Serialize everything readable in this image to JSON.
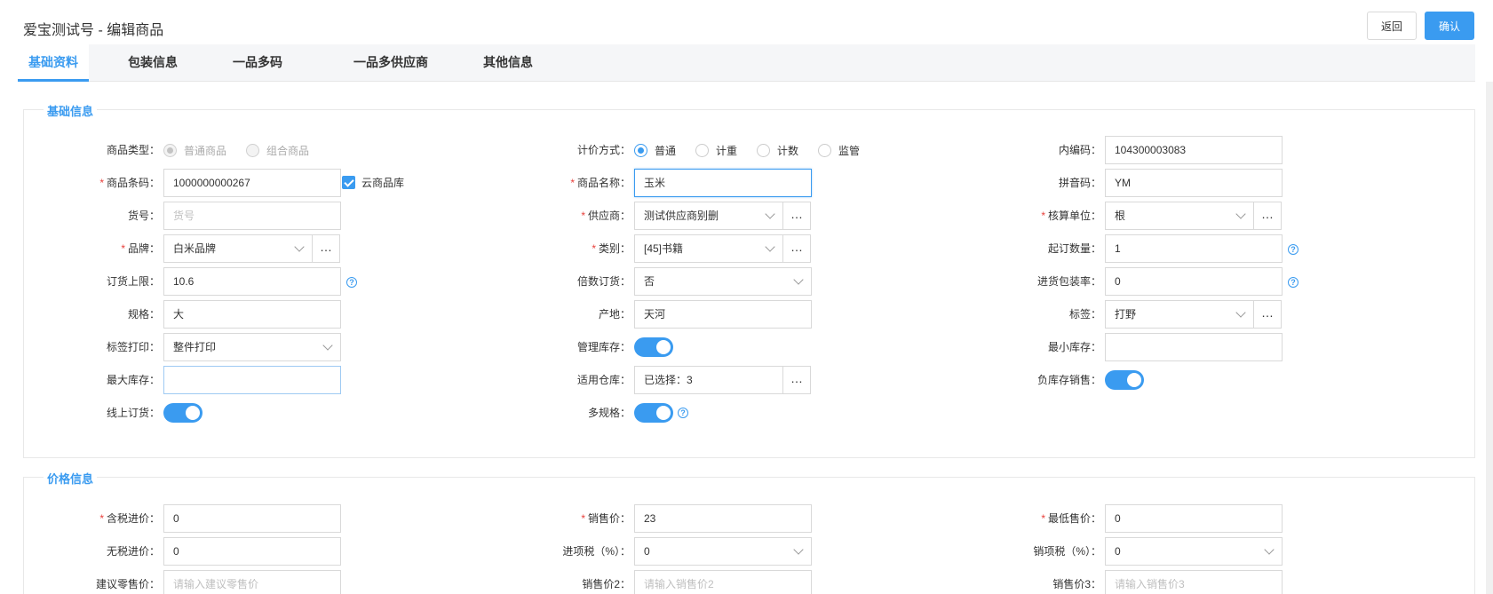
{
  "header": {
    "title": "爱宝测试号 - 编辑商品",
    "back_label": "返回",
    "confirm_label": "确认"
  },
  "tabs": [
    "基础资料",
    "包装信息",
    "一品多码",
    "一品多供应商",
    "其他信息"
  ],
  "basic": {
    "section_title": "基础信息",
    "product_type": {
      "label": "商品类型：",
      "options": [
        "普通商品",
        "组合商品"
      ]
    },
    "pricing_method": {
      "label": "计价方式：",
      "options": [
        "普通",
        "计重",
        "计数",
        "监管"
      ]
    },
    "internal_code": {
      "label": "内编码：",
      "value": "104300003083"
    },
    "barcode": {
      "label": "商品条码：",
      "value": "1000000000267",
      "cloud_label": "云商品库"
    },
    "name": {
      "label": "商品名称：",
      "value": "玉米"
    },
    "pinyin": {
      "label": "拼音码：",
      "value": "YM"
    },
    "item_no": {
      "label": "货号：",
      "placeholder": "货号"
    },
    "supplier": {
      "label": "供应商：",
      "value": "测试供应商别删"
    },
    "unit": {
      "label": "核算单位：",
      "value": "根"
    },
    "brand": {
      "label": "品牌：",
      "value": "白米品牌"
    },
    "category": {
      "label": "类别：",
      "value": "[45]书籍"
    },
    "min_order": {
      "label": "起订数量：",
      "value": "1"
    },
    "order_limit": {
      "label": "订货上限：",
      "value": "10.6"
    },
    "multiple_order": {
      "label": "倍数订货：",
      "value": "否"
    },
    "purchase_pack_rate": {
      "label": "进货包装率：",
      "value": "0"
    },
    "spec": {
      "label": "规格：",
      "value": "大"
    },
    "origin": {
      "label": "产地：",
      "value": "天河"
    },
    "tag": {
      "label": "标签：",
      "value": "打野"
    },
    "label_print": {
      "label": "标签打印：",
      "value": "整件打印"
    },
    "manage_stock": {
      "label": "管理库存："
    },
    "min_stock": {
      "label": "最小库存：",
      "value": ""
    },
    "max_stock": {
      "label": "最大库存：",
      "value": ""
    },
    "warehouses": {
      "label": "适用仓库：",
      "value": "已选择：3"
    },
    "negative_stock_sale": {
      "label": "负库存销售："
    },
    "online_order": {
      "label": "线上订货："
    },
    "multi_spec": {
      "label": "多规格："
    }
  },
  "price": {
    "section_title": "价格信息",
    "tax_purchase": {
      "label": "含税进价：",
      "value": "0"
    },
    "sale_price": {
      "label": "销售价：",
      "value": "23"
    },
    "lowest_price": {
      "label": "最低售价：",
      "value": "0"
    },
    "notax_purchase": {
      "label": "无税进价：",
      "value": "0"
    },
    "input_tax": {
      "label": "进项税（%）：",
      "value": "0"
    },
    "output_tax": {
      "label": "销项税（%）：",
      "value": "0"
    },
    "retail_price": {
      "label": "建议零售价：",
      "placeholder": "请输入建议零售价"
    },
    "sale_price2": {
      "label": "销售价2：",
      "placeholder": "请输入销售价2"
    },
    "sale_price3": {
      "label": "销售价3：",
      "placeholder": "请输入销售价3"
    }
  },
  "colors": {
    "accent": "#3a9bf0",
    "required": "#e8413c"
  }
}
